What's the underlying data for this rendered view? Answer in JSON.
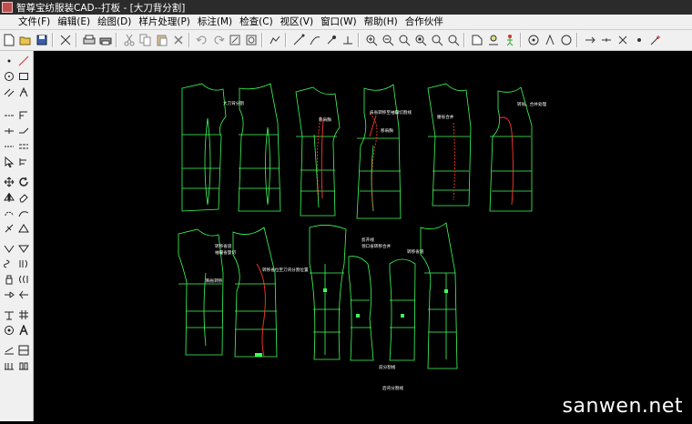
{
  "window": {
    "title": "智尊宝纺服装CAD--打板 - [大刀背分割]"
  },
  "menu": [
    "文件(F)",
    "编辑(E)",
    "绘图(D)",
    "样片处理(P)",
    "标注(M)",
    "检查(C)",
    "视区(V)",
    "窗口(W)",
    "帮助(H)",
    "合作伙伴"
  ],
  "icons": {
    "toolbar": [
      "new-icon",
      "open-icon",
      "save-icon",
      "cut-pattern-icon",
      "print-preview-icon",
      "print-icon",
      "scissors-icon",
      "copy-icon",
      "paste-icon",
      "delete-icon",
      "undo-icon",
      "redo-icon",
      "refresh-icon",
      "rotate-icon",
      "grid-icon",
      "pen-icon",
      "curve-pen-icon",
      "point-pen-icon",
      "segment-pen-icon",
      "zoom-in-icon",
      "zoom-out-icon",
      "zoom-window-icon",
      "zoom-fit-icon",
      "zoom-prev-icon",
      "zoom-all-icon",
      "measure-icon",
      "layer-icon",
      "figure-icon",
      "snap-icon",
      "angle-icon",
      "circle-icon",
      "arrow-right-icon",
      "dash-icon",
      "cross-icon",
      "dot-icon",
      "wand-icon"
    ],
    "sidebar": [
      "point-icon",
      "line-icon",
      "circle-tool-icon",
      "rect-tool-icon",
      "parallel-icon",
      "angle-tool-icon",
      "dash-line-icon",
      "ruler-icon",
      "cut-line-icon",
      "bend-line-icon",
      "dotted-icon",
      "chain-icon",
      "select-icon",
      "align-icon",
      "move-icon",
      "rotate-tool-icon",
      "mirror-icon",
      "eraser-icon",
      "lasso-icon",
      "curve-tool-icon",
      "node-icon",
      "triangle-icon",
      "v-icon",
      "fold-icon",
      "twist-icon",
      "seam-icon",
      "hand-icon",
      "wave-icon",
      "tuck-icon",
      "pleat-icon",
      "hem-icon",
      "compose-icon",
      "base-icon",
      "ruler-alt-icon",
      "target-icon",
      "text-icon",
      "sew-icon",
      "pattern-icon",
      "grade-icon",
      "book-icon"
    ]
  },
  "canvas": {
    "labels": {
      "g1_title": "大刀背分割",
      "g2_l1": "移肩胸",
      "g2_l2": "肩省转移至袖窿切割线",
      "g2_l3": "移肩胸",
      "g3_l1": "腰省合并",
      "g3_l2": "转省、合并处理",
      "g4_l1": "转移省道",
      "g4_l2": "袖窿省量切",
      "g4_l3": "胸省转移",
      "g4_l4": "转移省位至刀背分割位置",
      "g5_l1": "剪开线",
      "g5_l2": "领口省转移合并",
      "g5_l3": "转移省道",
      "g5_l4": "前分割线",
      "g5_l5": "后背分割线"
    }
  },
  "colors": {
    "pattern": "#3fff5a",
    "red_line": "#ff3a2a",
    "canvas_bg": "#000000",
    "chrome": "#f0f0f0"
  },
  "watermark": "sanwen.net"
}
